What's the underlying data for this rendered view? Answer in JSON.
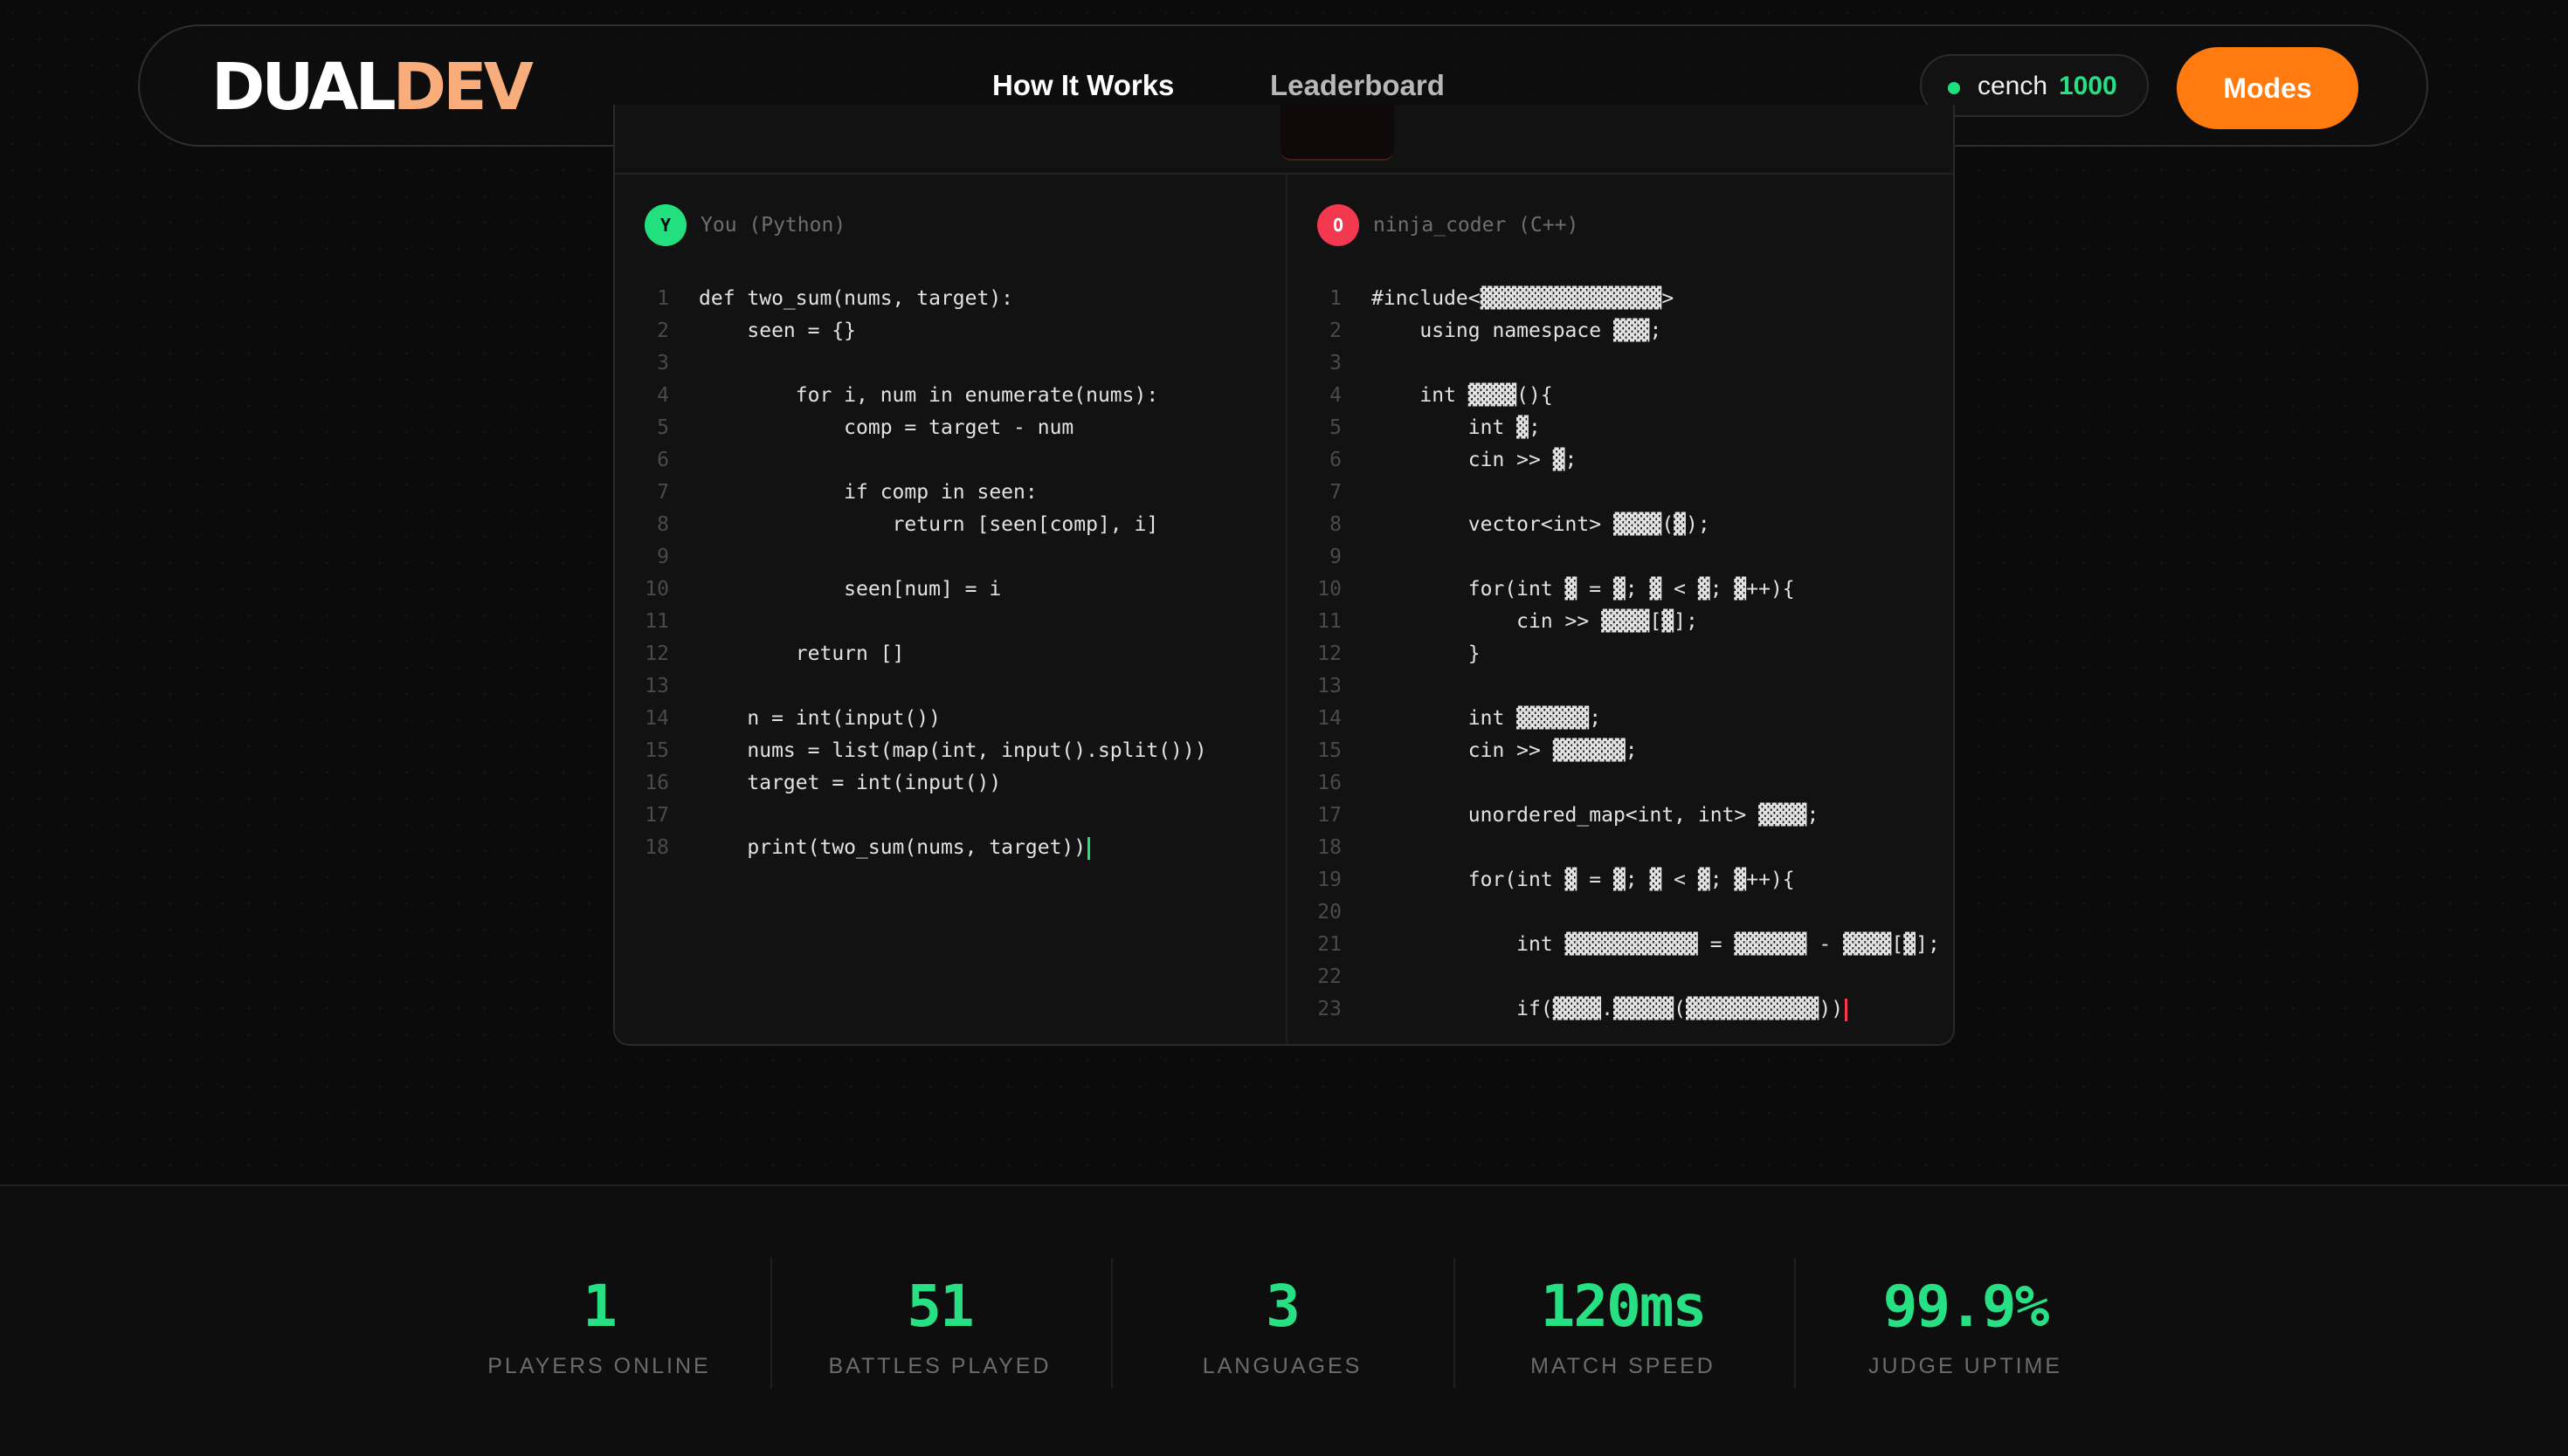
{
  "nav": {
    "logo_part1": "DUAL",
    "logo_part2": "DEV",
    "links": [
      "How It Works",
      "Leaderboard"
    ],
    "user": {
      "name": "cench",
      "rating": "1000",
      "status_color": "#1ee07d"
    },
    "modes_label": "Modes"
  },
  "editor": {
    "left": {
      "avatar": "Y",
      "label": "You (Python)",
      "lines": [
        "def two_sum(nums, target):",
        "    seen = {}",
        "",
        "        for i, num in enumerate(nums):",
        "            comp = target - num",
        "",
        "            if comp in seen:",
        "                return [seen[comp], i]",
        "",
        "            seen[num] = i",
        "",
        "        return []",
        "",
        "    n = int(input())",
        "    nums = list(map(int, input().split()))",
        "    target = int(input())",
        "",
        "    print(two_sum(nums, target))"
      ]
    },
    "right": {
      "avatar": "O",
      "label": "ninja_coder (C++)",
      "lines": [
        "#include<▓▓▓▓▓▓▓▓▓▓▓▓▓▓▓>",
        "    using namespace ▓▓▓;",
        "",
        "    int ▓▓▓▓(){",
        "        int ▓;",
        "        cin >> ▓;",
        "",
        "        vector<int> ▓▓▓▓(▓);",
        "",
        "        for(int ▓ = ▓; ▓ < ▓; ▓++){",
        "            cin >> ▓▓▓▓[▓];",
        "        }",
        "",
        "        int ▓▓▓▓▓▓;",
        "        cin >> ▓▓▓▓▓▓;",
        "",
        "        unordered_map<int, int> ▓▓▓▓;",
        "",
        "        for(int ▓ = ▓; ▓ < ▓; ▓++){",
        "",
        "            int ▓▓▓▓▓▓▓▓▓▓▓ = ▓▓▓▓▓▓ - ▓▓▓▓[▓];",
        "",
        "            if(▓▓▓▓.▓▓▓▓▓(▓▓▓▓▓▓▓▓▓▓▓))"
      ]
    }
  },
  "stats": [
    {
      "value": "1",
      "label": "PLAYERS ONLINE"
    },
    {
      "value": "51",
      "label": "BATTLES PLAYED"
    },
    {
      "value": "3",
      "label": "LANGUAGES"
    },
    {
      "value": "120ms",
      "label": "MATCH SPEED"
    },
    {
      "value": "99.9%",
      "label": "JUDGE UPTIME"
    }
  ],
  "colors": {
    "accent_green": "#27e083",
    "accent_orange": "#ff7a0f",
    "logo_peach": "#f9ad7b",
    "opponent_red": "#f3394f"
  }
}
